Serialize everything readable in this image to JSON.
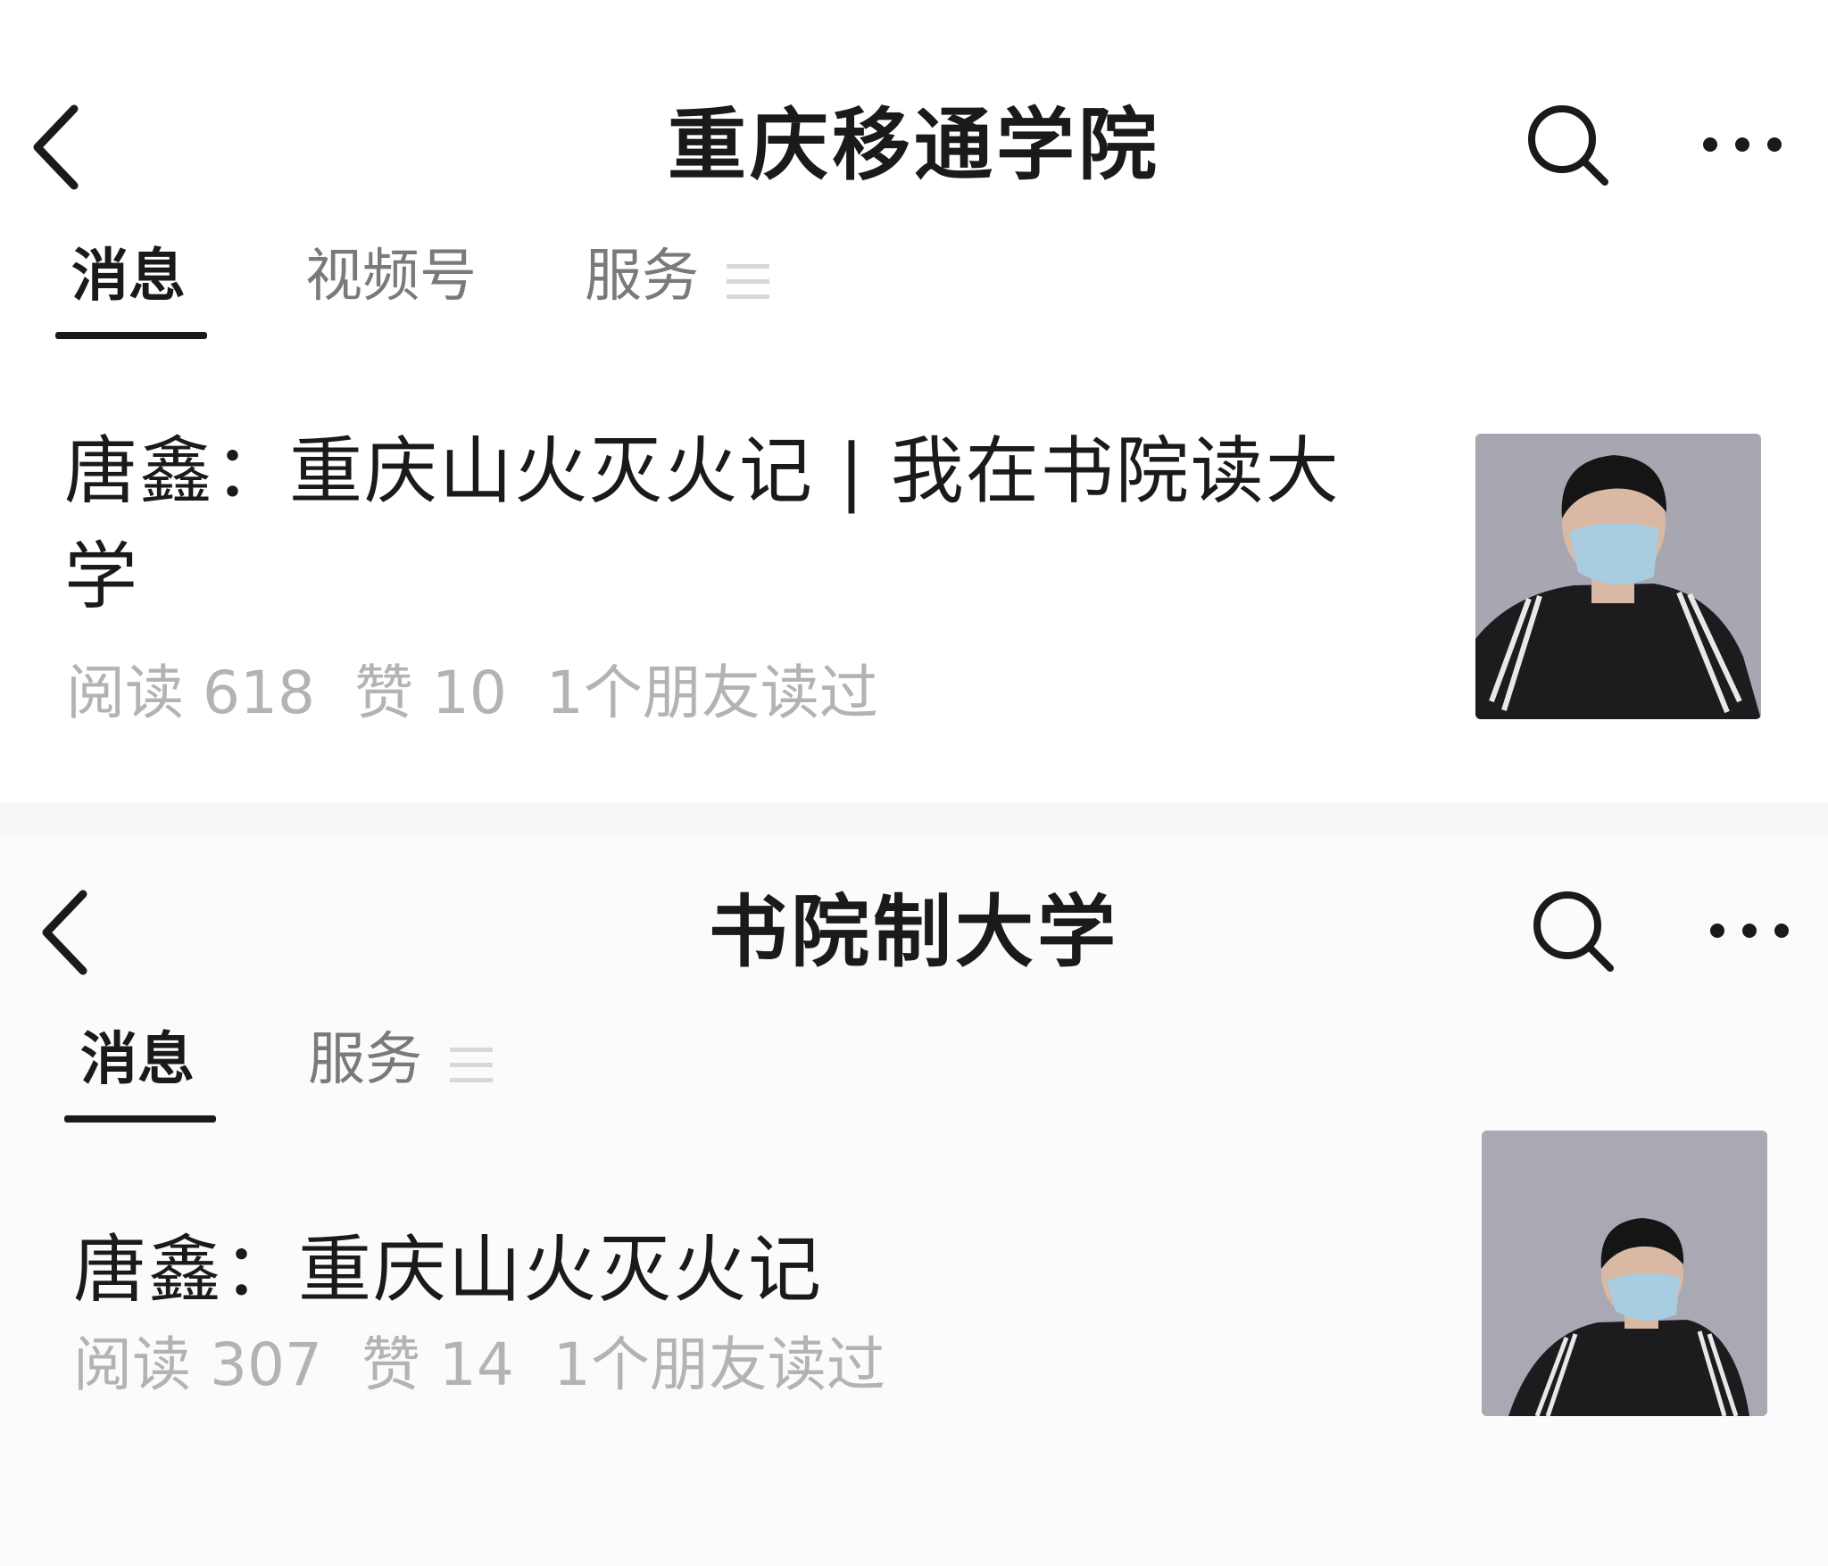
{
  "panels": [
    {
      "header": {
        "title": "重庆移通学院",
        "back_icon": "chevron-left-icon",
        "search_icon": "search-icon",
        "more_icon": "more-dots-icon"
      },
      "tabs": [
        {
          "label": "消息",
          "active": true
        },
        {
          "label": "视频号",
          "active": false
        },
        {
          "label": "服务",
          "active": false
        }
      ],
      "article": {
        "title": "唐鑫：重庆山火灭火记 | 我在书院读大学",
        "reads": "阅读 618",
        "likes": "赞 10",
        "friends": "1个朋友读过",
        "thumbnail": "photo of a young man in a face mask wearing a black track jacket"
      }
    },
    {
      "header": {
        "title": "书院制大学",
        "back_icon": "chevron-left-icon",
        "search_icon": "search-icon",
        "more_icon": "more-dots-icon"
      },
      "tabs": [
        {
          "label": "消息",
          "active": true
        },
        {
          "label": "服务",
          "active": false
        }
      ],
      "article": {
        "title": "唐鑫：重庆山火灭火记",
        "reads": "阅读 307",
        "likes": "赞 14",
        "friends": "1个朋友读过",
        "thumbnail": "photo of a young man in a face mask wearing a black track jacket"
      }
    }
  ],
  "colors": {
    "text": "#1a1a1a",
    "tab_inactive": "#7a7a7a",
    "meta": "#b3b3b3",
    "thumb_bg": "#a6a7b1"
  }
}
